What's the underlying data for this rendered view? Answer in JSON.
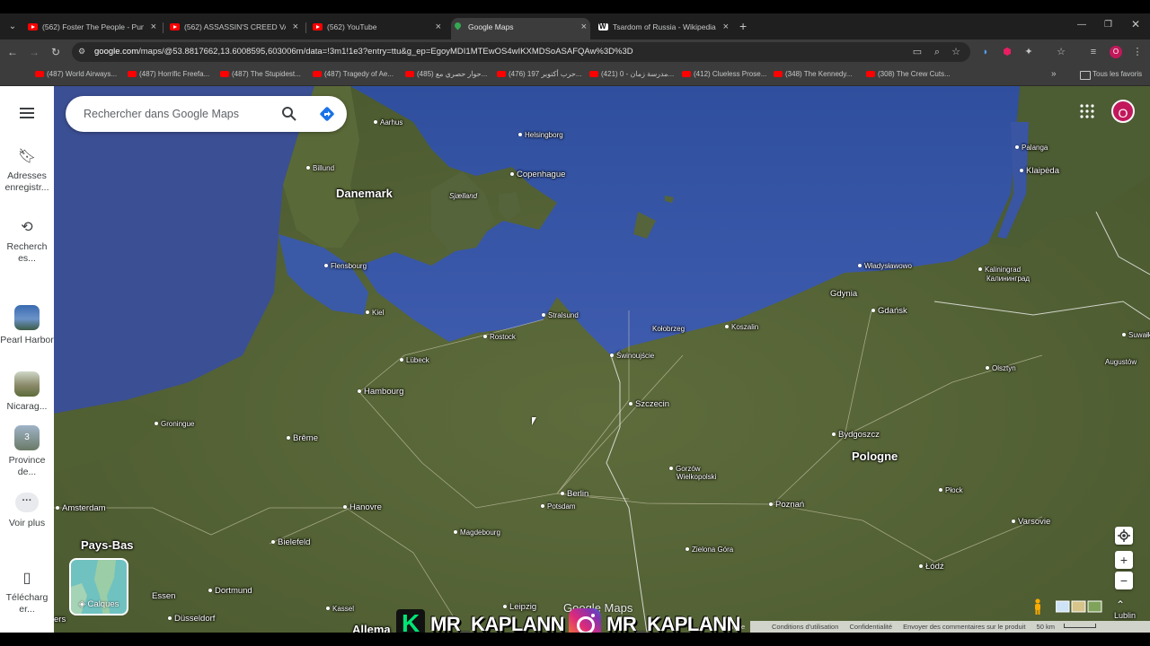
{
  "browser": {
    "tabs": [
      {
        "title": "(562) Foster The People - Pump",
        "close": "×"
      },
      {
        "title": "(562) ASSASSIN'S CREED VALHA",
        "close": "×"
      },
      {
        "title": "(562) YouTube",
        "close": "×"
      },
      {
        "title": "Google Maps",
        "close": "×"
      },
      {
        "title": "Tsardom of Russia - Wikipedia",
        "close": "×"
      }
    ],
    "new_tab": "+",
    "url_host": "google.com",
    "url_path": "/maps/@53.8817662,13.6008595,603006m/data=!3m1!1e3?entry=ttu&g_ep=EgoyMDI1MTEwOS4wIKXMDSoASAFQAw%3D%3D",
    "bookmarks": [
      "(487) World Airways...",
      "(487) Horrific Freefa...",
      "(487) The Stupidest...",
      "(487) Tragedy of Ae...",
      "(485) حوار حصري مع...",
      "(476) حرب أكتوبر 197...",
      "(421) مدرسة زمان - 0...",
      "(412) Clueless Prose...",
      "(348) The Kennedy...",
      "(308) The Crew Cuts..."
    ],
    "bookmarks_more": "»",
    "all_bookmarks": "Tous les favoris",
    "profile_initial": "O"
  },
  "sidebar": {
    "saved": "Adresses enregistr...",
    "recent": "Recherch es...",
    "recents": [
      {
        "label": "Pearl Harbor"
      },
      {
        "label": "Nicarag..."
      },
      {
        "label": "Province de...",
        "badge": "3"
      }
    ],
    "more": "Voir plus",
    "more_dots": "···",
    "download": "Télécharg er..."
  },
  "search": {
    "placeholder": "Rechercher dans Google Maps"
  },
  "avatar_initial": "O",
  "layers_label": "Calques",
  "map_watermark": "Google Maps",
  "zoom_in": "+",
  "zoom_out": "−",
  "expand": "⌃",
  "attribution": {
    "links": [
      "Conditions d'utilisation",
      "Confidentialité",
      "Envoyer des commentaires sur le produit"
    ],
    "scale": "50 km",
    "partial_left": "igue",
    "partial_right": "Lublin"
  },
  "overlay": {
    "k_letter": "K",
    "handle1": "MR_KAPLANN",
    "handle2": "MR_KAPLANN"
  },
  "map_labels": {
    "countries": [
      "Danemark",
      "Pologne",
      "Pays-Bas"
    ],
    "major": [
      "Copenhague",
      "Hambourg",
      "Szczecin",
      "Berlin",
      "Gdańsk",
      "Klaipėda",
      "Gdynia",
      "Brême",
      "Hanovre",
      "Amsterdam",
      "Poznań",
      "Bydgoszcz",
      "Varsovie",
      "Łódź",
      "Dortmund",
      "Bielefeld",
      "Essen",
      "Düsseldorf"
    ],
    "minor": [
      "Aarhus",
      "Helsingborg",
      "Billund",
      "Sjælland",
      "Flensbourg",
      "Kiel",
      "Lübeck",
      "Rostock",
      "Stralsund",
      "Świnoujście",
      "Kołobrzeg",
      "Koszalin",
      "Władysławowo",
      "Kaliningrad",
      "Калининград",
      "Palanga",
      "Olsztyn",
      "Augustów",
      "Groningue",
      "Gorzów",
      "Wielkopolski",
      "Potsdam",
      "Magdebourg",
      "Zielona Góra",
      "Płock",
      "Leipzig",
      "Kassel",
      "Suwałki",
      "Allema",
      "ers"
    ]
  }
}
